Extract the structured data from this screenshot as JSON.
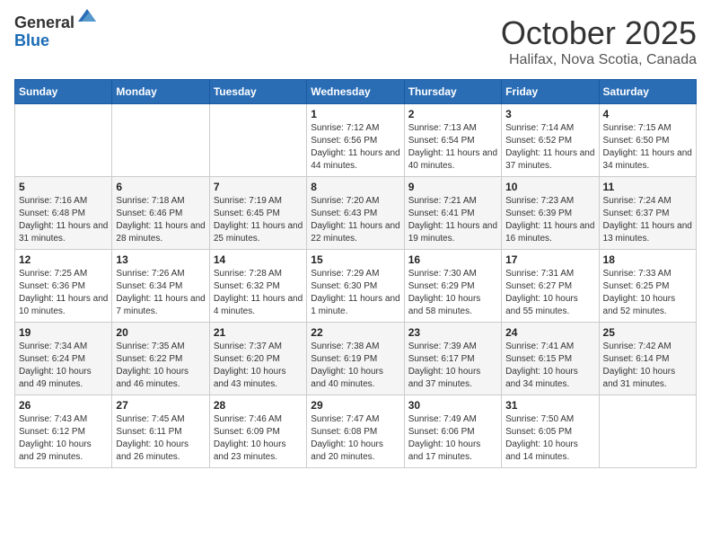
{
  "logo": {
    "general": "General",
    "blue": "Blue"
  },
  "title": "October 2025",
  "subtitle": "Halifax, Nova Scotia, Canada",
  "days_of_week": [
    "Sunday",
    "Monday",
    "Tuesday",
    "Wednesday",
    "Thursday",
    "Friday",
    "Saturday"
  ],
  "weeks": [
    [
      {
        "day": "",
        "sunrise": "",
        "sunset": "",
        "daylight": ""
      },
      {
        "day": "",
        "sunrise": "",
        "sunset": "",
        "daylight": ""
      },
      {
        "day": "",
        "sunrise": "",
        "sunset": "",
        "daylight": ""
      },
      {
        "day": "1",
        "sunrise": "Sunrise: 7:12 AM",
        "sunset": "Sunset: 6:56 PM",
        "daylight": "Daylight: 11 hours and 44 minutes."
      },
      {
        "day": "2",
        "sunrise": "Sunrise: 7:13 AM",
        "sunset": "Sunset: 6:54 PM",
        "daylight": "Daylight: 11 hours and 40 minutes."
      },
      {
        "day": "3",
        "sunrise": "Sunrise: 7:14 AM",
        "sunset": "Sunset: 6:52 PM",
        "daylight": "Daylight: 11 hours and 37 minutes."
      },
      {
        "day": "4",
        "sunrise": "Sunrise: 7:15 AM",
        "sunset": "Sunset: 6:50 PM",
        "daylight": "Daylight: 11 hours and 34 minutes."
      }
    ],
    [
      {
        "day": "5",
        "sunrise": "Sunrise: 7:16 AM",
        "sunset": "Sunset: 6:48 PM",
        "daylight": "Daylight: 11 hours and 31 minutes."
      },
      {
        "day": "6",
        "sunrise": "Sunrise: 7:18 AM",
        "sunset": "Sunset: 6:46 PM",
        "daylight": "Daylight: 11 hours and 28 minutes."
      },
      {
        "day": "7",
        "sunrise": "Sunrise: 7:19 AM",
        "sunset": "Sunset: 6:45 PM",
        "daylight": "Daylight: 11 hours and 25 minutes."
      },
      {
        "day": "8",
        "sunrise": "Sunrise: 7:20 AM",
        "sunset": "Sunset: 6:43 PM",
        "daylight": "Daylight: 11 hours and 22 minutes."
      },
      {
        "day": "9",
        "sunrise": "Sunrise: 7:21 AM",
        "sunset": "Sunset: 6:41 PM",
        "daylight": "Daylight: 11 hours and 19 minutes."
      },
      {
        "day": "10",
        "sunrise": "Sunrise: 7:23 AM",
        "sunset": "Sunset: 6:39 PM",
        "daylight": "Daylight: 11 hours and 16 minutes."
      },
      {
        "day": "11",
        "sunrise": "Sunrise: 7:24 AM",
        "sunset": "Sunset: 6:37 PM",
        "daylight": "Daylight: 11 hours and 13 minutes."
      }
    ],
    [
      {
        "day": "12",
        "sunrise": "Sunrise: 7:25 AM",
        "sunset": "Sunset: 6:36 PM",
        "daylight": "Daylight: 11 hours and 10 minutes."
      },
      {
        "day": "13",
        "sunrise": "Sunrise: 7:26 AM",
        "sunset": "Sunset: 6:34 PM",
        "daylight": "Daylight: 11 hours and 7 minutes."
      },
      {
        "day": "14",
        "sunrise": "Sunrise: 7:28 AM",
        "sunset": "Sunset: 6:32 PM",
        "daylight": "Daylight: 11 hours and 4 minutes."
      },
      {
        "day": "15",
        "sunrise": "Sunrise: 7:29 AM",
        "sunset": "Sunset: 6:30 PM",
        "daylight": "Daylight: 11 hours and 1 minute."
      },
      {
        "day": "16",
        "sunrise": "Sunrise: 7:30 AM",
        "sunset": "Sunset: 6:29 PM",
        "daylight": "Daylight: 10 hours and 58 minutes."
      },
      {
        "day": "17",
        "sunrise": "Sunrise: 7:31 AM",
        "sunset": "Sunset: 6:27 PM",
        "daylight": "Daylight: 10 hours and 55 minutes."
      },
      {
        "day": "18",
        "sunrise": "Sunrise: 7:33 AM",
        "sunset": "Sunset: 6:25 PM",
        "daylight": "Daylight: 10 hours and 52 minutes."
      }
    ],
    [
      {
        "day": "19",
        "sunrise": "Sunrise: 7:34 AM",
        "sunset": "Sunset: 6:24 PM",
        "daylight": "Daylight: 10 hours and 49 minutes."
      },
      {
        "day": "20",
        "sunrise": "Sunrise: 7:35 AM",
        "sunset": "Sunset: 6:22 PM",
        "daylight": "Daylight: 10 hours and 46 minutes."
      },
      {
        "day": "21",
        "sunrise": "Sunrise: 7:37 AM",
        "sunset": "Sunset: 6:20 PM",
        "daylight": "Daylight: 10 hours and 43 minutes."
      },
      {
        "day": "22",
        "sunrise": "Sunrise: 7:38 AM",
        "sunset": "Sunset: 6:19 PM",
        "daylight": "Daylight: 10 hours and 40 minutes."
      },
      {
        "day": "23",
        "sunrise": "Sunrise: 7:39 AM",
        "sunset": "Sunset: 6:17 PM",
        "daylight": "Daylight: 10 hours and 37 minutes."
      },
      {
        "day": "24",
        "sunrise": "Sunrise: 7:41 AM",
        "sunset": "Sunset: 6:15 PM",
        "daylight": "Daylight: 10 hours and 34 minutes."
      },
      {
        "day": "25",
        "sunrise": "Sunrise: 7:42 AM",
        "sunset": "Sunset: 6:14 PM",
        "daylight": "Daylight: 10 hours and 31 minutes."
      }
    ],
    [
      {
        "day": "26",
        "sunrise": "Sunrise: 7:43 AM",
        "sunset": "Sunset: 6:12 PM",
        "daylight": "Daylight: 10 hours and 29 minutes."
      },
      {
        "day": "27",
        "sunrise": "Sunrise: 7:45 AM",
        "sunset": "Sunset: 6:11 PM",
        "daylight": "Daylight: 10 hours and 26 minutes."
      },
      {
        "day": "28",
        "sunrise": "Sunrise: 7:46 AM",
        "sunset": "Sunset: 6:09 PM",
        "daylight": "Daylight: 10 hours and 23 minutes."
      },
      {
        "day": "29",
        "sunrise": "Sunrise: 7:47 AM",
        "sunset": "Sunset: 6:08 PM",
        "daylight": "Daylight: 10 hours and 20 minutes."
      },
      {
        "day": "30",
        "sunrise": "Sunrise: 7:49 AM",
        "sunset": "Sunset: 6:06 PM",
        "daylight": "Daylight: 10 hours and 17 minutes."
      },
      {
        "day": "31",
        "sunrise": "Sunrise: 7:50 AM",
        "sunset": "Sunset: 6:05 PM",
        "daylight": "Daylight: 10 hours and 14 minutes."
      },
      {
        "day": "",
        "sunrise": "",
        "sunset": "",
        "daylight": ""
      }
    ]
  ]
}
